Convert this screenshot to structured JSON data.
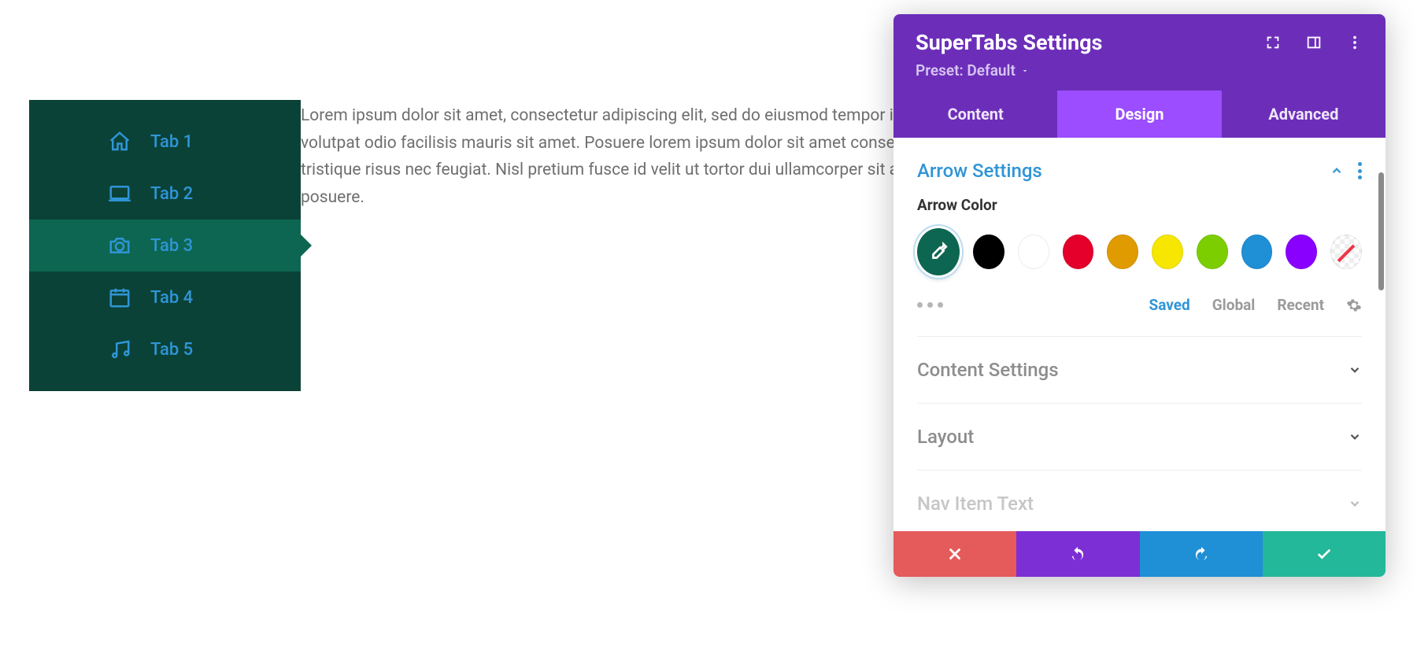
{
  "content": {
    "paragraph": "Lorem ipsum dolor sit amet, consectetur adipiscing elit, sed do eiusmod tempor incididunt ut labore. Massa orci sagittis eu volutpat odio facilisis mauris sit amet. Posuere lorem ipsum dolor sit amet consectetur adipiscing diam donec adipiscing tristique risus nec feugiat. Nisl pretium fusce id velit ut tortor dui ullamcorper sit amet risus nullam eget. Eleifend mi in nulla posuere."
  },
  "tabs": {
    "items": [
      {
        "label": "Tab 1",
        "icon": "home-icon",
        "active": false
      },
      {
        "label": "Tab 2",
        "icon": "laptop-icon",
        "active": false
      },
      {
        "label": "Tab 3",
        "icon": "camera-icon",
        "active": true
      },
      {
        "label": "Tab 4",
        "icon": "calendar-icon",
        "active": false
      },
      {
        "label": "Tab 5",
        "icon": "music-icon",
        "active": false
      }
    ]
  },
  "panel": {
    "title": "SuperTabs Settings",
    "preset_label": "Preset: Default",
    "tabs": [
      {
        "label": "Content",
        "state": "inactive"
      },
      {
        "label": "Design",
        "state": "active"
      },
      {
        "label": "Advanced",
        "state": "inactive"
      }
    ],
    "section_open": "Arrow Settings",
    "field_label": "Arrow Color",
    "swatches": [
      {
        "color": "#0d6651",
        "selected": true,
        "name": "teal"
      },
      {
        "color": "#000000",
        "selected": false,
        "name": "black"
      },
      {
        "color": "#ffffff",
        "selected": false,
        "name": "white"
      },
      {
        "color": "#e4002b",
        "selected": false,
        "name": "red"
      },
      {
        "color": "#e09b00",
        "selected": false,
        "name": "orange"
      },
      {
        "color": "#f6e600",
        "selected": false,
        "name": "yellow"
      },
      {
        "color": "#7cce00",
        "selected": false,
        "name": "green"
      },
      {
        "color": "#1f8fd6",
        "selected": false,
        "name": "blue"
      },
      {
        "color": "#8a00ff",
        "selected": false,
        "name": "purple"
      },
      {
        "color": "none",
        "selected": false,
        "name": "transparent"
      }
    ],
    "palette_tabs": {
      "saved": "Saved",
      "global": "Global",
      "recent": "Recent",
      "active": "saved"
    },
    "collapsed_sections": [
      "Content Settings",
      "Layout",
      "Nav Item Text"
    ]
  }
}
